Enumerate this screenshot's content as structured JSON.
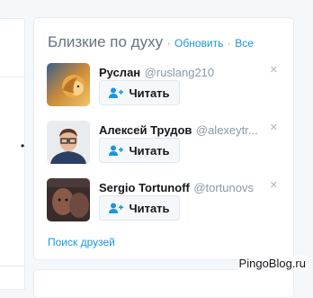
{
  "who_to_follow": {
    "title": "Близкие по духу",
    "separator": "·",
    "refresh_label": "Обновить",
    "all_label": "Все",
    "users": [
      {
        "name": "Руслан",
        "handle": "@ruslang210",
        "follow_label": "Читать",
        "dismiss": "×",
        "avatar": "lion-avatar"
      },
      {
        "name": "Алексей Трудов",
        "handle": "@alexeytr...",
        "follow_label": "Читать",
        "dismiss": "×",
        "avatar": "man-glasses-avatar"
      },
      {
        "name": "Sergio Tortunoff",
        "handle": "@tortunovs",
        "follow_label": "Читать",
        "dismiss": "×",
        "avatar": "dark-photo-avatar"
      }
    ],
    "find_friends_label": "Поиск друзей"
  },
  "left_column": {
    "bullet": "•"
  },
  "watermark": "PingoBlog.ru",
  "colors": {
    "accent": "#1b95e0",
    "text": "#14171a",
    "muted": "#8899a6",
    "border": "#e6ecf0"
  }
}
